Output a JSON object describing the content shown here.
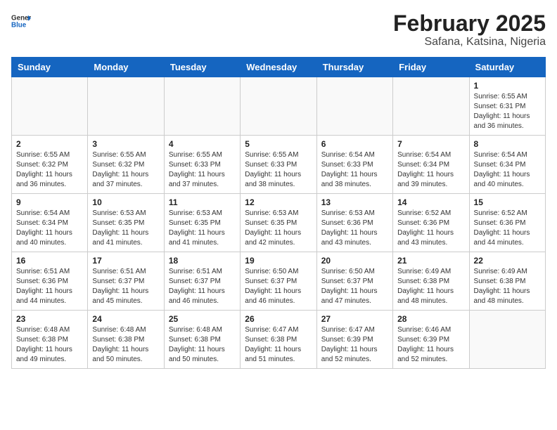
{
  "header": {
    "logo_general": "General",
    "logo_blue": "Blue",
    "main_title": "February 2025",
    "sub_title": "Safana, Katsina, Nigeria"
  },
  "calendar": {
    "days_of_week": [
      "Sunday",
      "Monday",
      "Tuesday",
      "Wednesday",
      "Thursday",
      "Friday",
      "Saturday"
    ],
    "weeks": [
      [
        {
          "day": "",
          "info": ""
        },
        {
          "day": "",
          "info": ""
        },
        {
          "day": "",
          "info": ""
        },
        {
          "day": "",
          "info": ""
        },
        {
          "day": "",
          "info": ""
        },
        {
          "day": "",
          "info": ""
        },
        {
          "day": "1",
          "info": "Sunrise: 6:55 AM\nSunset: 6:31 PM\nDaylight: 11 hours\nand 36 minutes."
        }
      ],
      [
        {
          "day": "2",
          "info": "Sunrise: 6:55 AM\nSunset: 6:32 PM\nDaylight: 11 hours\nand 36 minutes."
        },
        {
          "day": "3",
          "info": "Sunrise: 6:55 AM\nSunset: 6:32 PM\nDaylight: 11 hours\nand 37 minutes."
        },
        {
          "day": "4",
          "info": "Sunrise: 6:55 AM\nSunset: 6:33 PM\nDaylight: 11 hours\nand 37 minutes."
        },
        {
          "day": "5",
          "info": "Sunrise: 6:55 AM\nSunset: 6:33 PM\nDaylight: 11 hours\nand 38 minutes."
        },
        {
          "day": "6",
          "info": "Sunrise: 6:54 AM\nSunset: 6:33 PM\nDaylight: 11 hours\nand 38 minutes."
        },
        {
          "day": "7",
          "info": "Sunrise: 6:54 AM\nSunset: 6:34 PM\nDaylight: 11 hours\nand 39 minutes."
        },
        {
          "day": "8",
          "info": "Sunrise: 6:54 AM\nSunset: 6:34 PM\nDaylight: 11 hours\nand 40 minutes."
        }
      ],
      [
        {
          "day": "9",
          "info": "Sunrise: 6:54 AM\nSunset: 6:34 PM\nDaylight: 11 hours\nand 40 minutes."
        },
        {
          "day": "10",
          "info": "Sunrise: 6:53 AM\nSunset: 6:35 PM\nDaylight: 11 hours\nand 41 minutes."
        },
        {
          "day": "11",
          "info": "Sunrise: 6:53 AM\nSunset: 6:35 PM\nDaylight: 11 hours\nand 41 minutes."
        },
        {
          "day": "12",
          "info": "Sunrise: 6:53 AM\nSunset: 6:35 PM\nDaylight: 11 hours\nand 42 minutes."
        },
        {
          "day": "13",
          "info": "Sunrise: 6:53 AM\nSunset: 6:36 PM\nDaylight: 11 hours\nand 43 minutes."
        },
        {
          "day": "14",
          "info": "Sunrise: 6:52 AM\nSunset: 6:36 PM\nDaylight: 11 hours\nand 43 minutes."
        },
        {
          "day": "15",
          "info": "Sunrise: 6:52 AM\nSunset: 6:36 PM\nDaylight: 11 hours\nand 44 minutes."
        }
      ],
      [
        {
          "day": "16",
          "info": "Sunrise: 6:51 AM\nSunset: 6:36 PM\nDaylight: 11 hours\nand 44 minutes."
        },
        {
          "day": "17",
          "info": "Sunrise: 6:51 AM\nSunset: 6:37 PM\nDaylight: 11 hours\nand 45 minutes."
        },
        {
          "day": "18",
          "info": "Sunrise: 6:51 AM\nSunset: 6:37 PM\nDaylight: 11 hours\nand 46 minutes."
        },
        {
          "day": "19",
          "info": "Sunrise: 6:50 AM\nSunset: 6:37 PM\nDaylight: 11 hours\nand 46 minutes."
        },
        {
          "day": "20",
          "info": "Sunrise: 6:50 AM\nSunset: 6:37 PM\nDaylight: 11 hours\nand 47 minutes."
        },
        {
          "day": "21",
          "info": "Sunrise: 6:49 AM\nSunset: 6:38 PM\nDaylight: 11 hours\nand 48 minutes."
        },
        {
          "day": "22",
          "info": "Sunrise: 6:49 AM\nSunset: 6:38 PM\nDaylight: 11 hours\nand 48 minutes."
        }
      ],
      [
        {
          "day": "23",
          "info": "Sunrise: 6:48 AM\nSunset: 6:38 PM\nDaylight: 11 hours\nand 49 minutes."
        },
        {
          "day": "24",
          "info": "Sunrise: 6:48 AM\nSunset: 6:38 PM\nDaylight: 11 hours\nand 50 minutes."
        },
        {
          "day": "25",
          "info": "Sunrise: 6:48 AM\nSunset: 6:38 PM\nDaylight: 11 hours\nand 50 minutes."
        },
        {
          "day": "26",
          "info": "Sunrise: 6:47 AM\nSunset: 6:38 PM\nDaylight: 11 hours\nand 51 minutes."
        },
        {
          "day": "27",
          "info": "Sunrise: 6:47 AM\nSunset: 6:39 PM\nDaylight: 11 hours\nand 52 minutes."
        },
        {
          "day": "28",
          "info": "Sunrise: 6:46 AM\nSunset: 6:39 PM\nDaylight: 11 hours\nand 52 minutes."
        },
        {
          "day": "",
          "info": ""
        }
      ]
    ]
  }
}
